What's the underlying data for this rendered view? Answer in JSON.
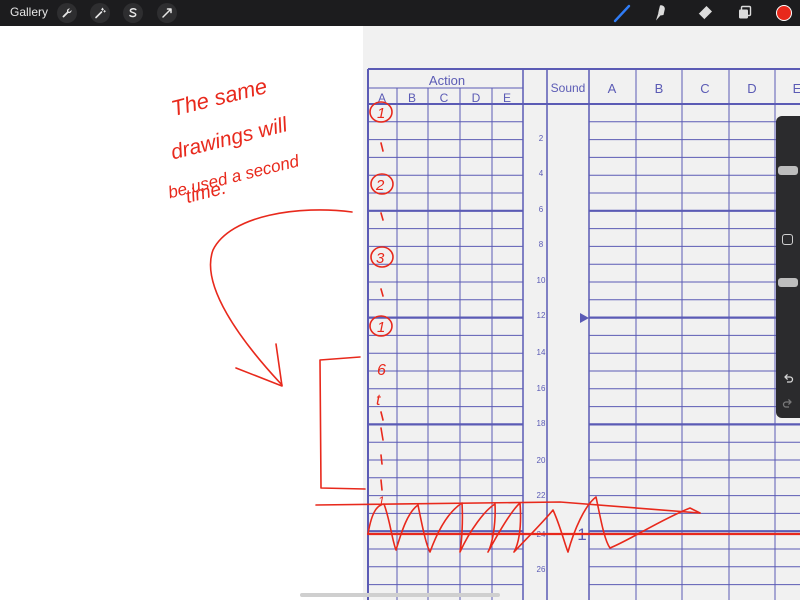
{
  "toolbar": {
    "gallery_label": "Gallery",
    "left_tools": [
      "wrench-icon",
      "magic-wand-icon",
      "selection-icon",
      "transform-icon"
    ],
    "right_tools": [
      "brush-icon",
      "smudge-icon",
      "eraser-icon",
      "layers-icon"
    ],
    "current_color": "#e8291c"
  },
  "sheet": {
    "action_header": "Action",
    "action_columns": [
      "A",
      "B",
      "C",
      "D",
      "E"
    ],
    "sound_header": "Sound",
    "camera_columns": [
      "A",
      "B",
      "C",
      "D",
      "E"
    ],
    "frame_numbers": [
      "2",
      "4",
      "6",
      "8",
      "10",
      "12",
      "14",
      "16",
      "18",
      "20",
      "22",
      "24",
      "26"
    ],
    "grid_color": "#5b5bb5"
  },
  "annotations": {
    "note_lines": [
      "The same",
      "drawings will",
      "be used a second",
      "time."
    ],
    "column_marks": [
      "1",
      "2",
      "3",
      "1",
      "6",
      "t",
      "1"
    ],
    "page_mark": "1",
    "ink_color": "#e8291c"
  },
  "sidebar": {
    "size_level": 0.25,
    "opacity_level": 0.4,
    "icons": [
      "square-icon",
      "undo-icon",
      "redo-icon"
    ]
  }
}
